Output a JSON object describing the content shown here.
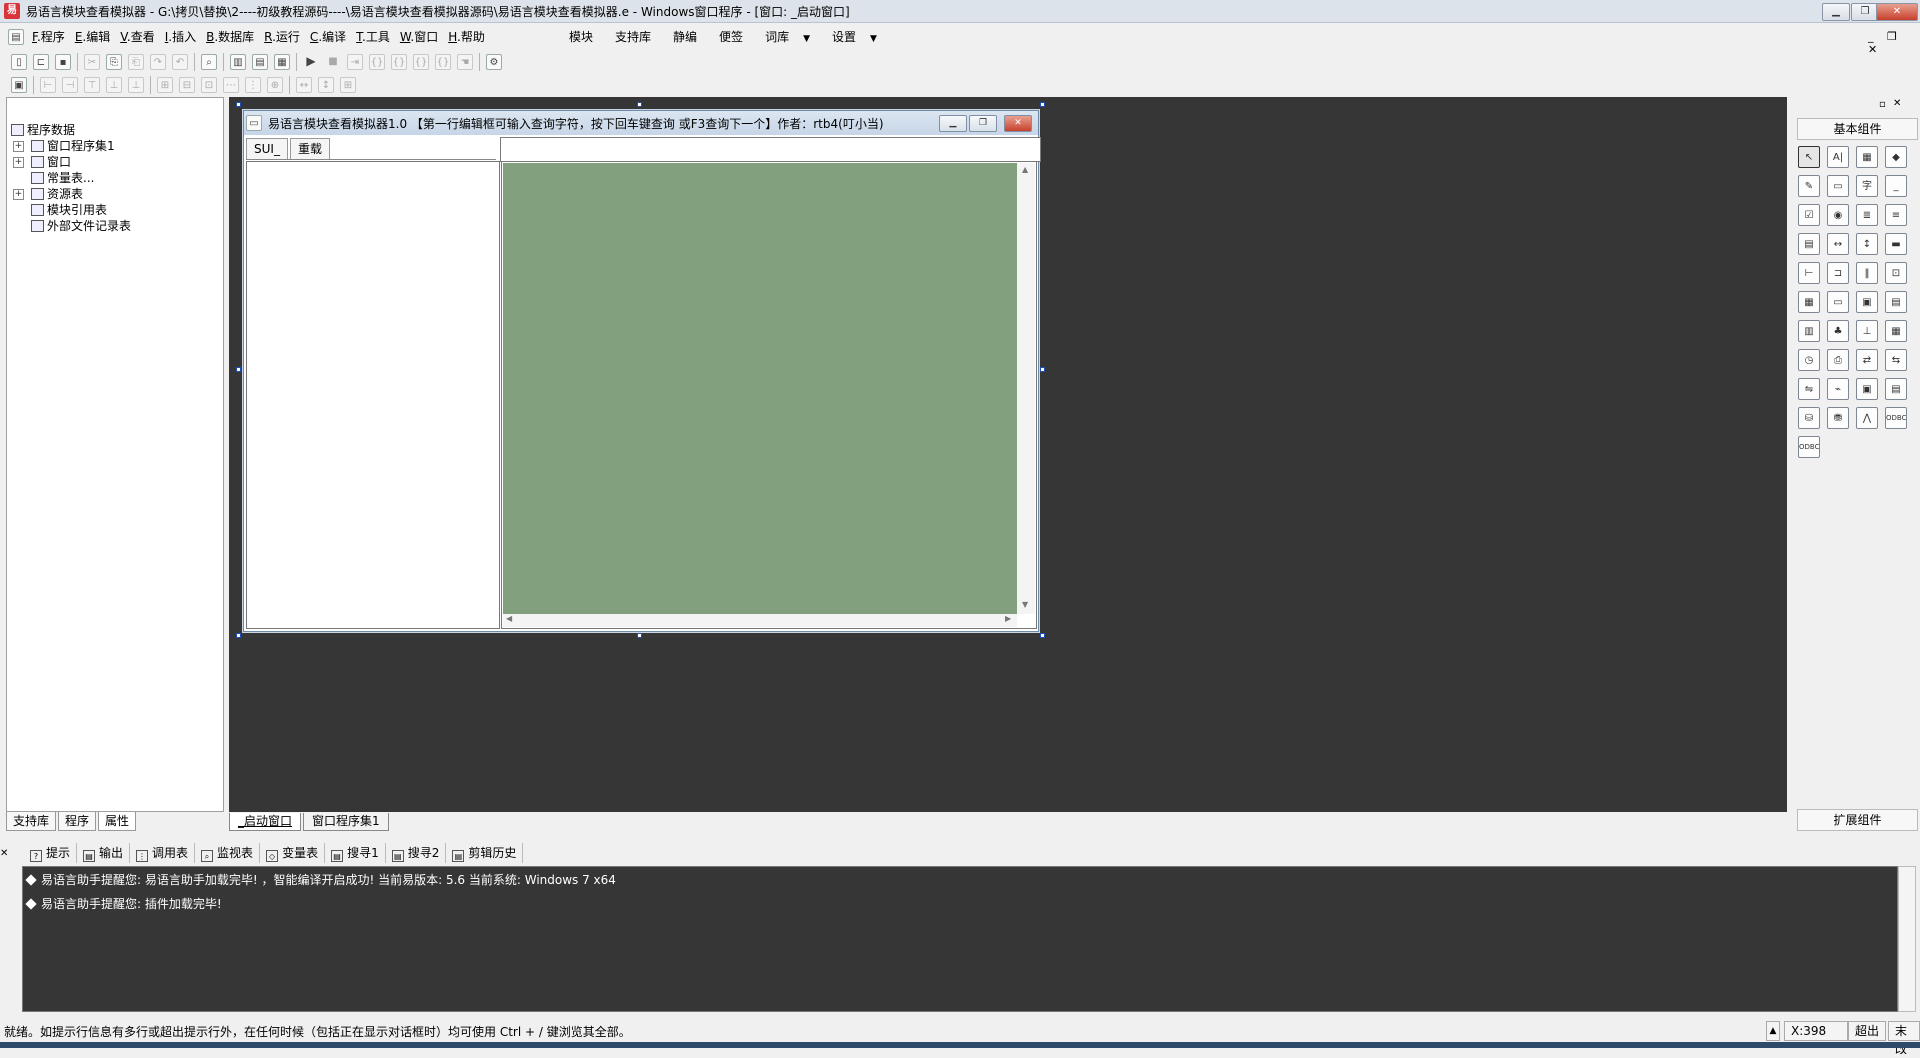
{
  "window": {
    "title": "易语言模块查看模拟器 - G:\\拷贝\\替换\\2----初级教程源码----\\易语言模块查看模拟器源码\\易语言模块查看模拟器.e - Windows窗口程序 - [窗口: _启动窗口]"
  },
  "menu": {
    "items": [
      {
        "key": "F",
        "label": ".程序"
      },
      {
        "key": "E",
        "label": ".编辑"
      },
      {
        "key": "V",
        "label": ".查看"
      },
      {
        "key": "I",
        "label": ".插入"
      },
      {
        "key": "B",
        "label": ".数据库"
      },
      {
        "key": "R",
        "label": ".运行"
      },
      {
        "key": "C",
        "label": ".编译"
      },
      {
        "key": "T",
        "label": ".工具"
      },
      {
        "key": "W",
        "label": ".窗口"
      },
      {
        "key": "H",
        "label": ".帮助"
      }
    ],
    "right_items": [
      "模块",
      "支持库",
      "静编",
      "便签",
      "词库",
      "设置"
    ]
  },
  "tree": {
    "root": "程序数据",
    "items": [
      {
        "label": "窗口程序集1",
        "expander": "+"
      },
      {
        "label": "窗口",
        "expander": "+"
      },
      {
        "label": "常量表...",
        "expander": ""
      },
      {
        "label": "资源表",
        "expander": "+"
      },
      {
        "label": "模块引用表",
        "expander": ""
      },
      {
        "label": "外部文件记录表",
        "expander": ""
      }
    ]
  },
  "left_tabs": [
    "支持库",
    "程序",
    "属性"
  ],
  "form": {
    "title": "易语言模块查看模拟器1.0 【第一行编辑框可输入查询字符，按下回车键查询 或F3查询下一个】作者：rtb4(叮小当)",
    "tabs": [
      "SUI_",
      "重载"
    ],
    "search_value": ""
  },
  "design_tabs": [
    "_启动窗口",
    "窗口程序集1"
  ],
  "components": {
    "header": "基本组件",
    "footer": "扩展组件",
    "icons": [
      {
        "name": "pointer-icon",
        "glyph": "↖"
      },
      {
        "name": "label-icon",
        "glyph": "A|"
      },
      {
        "name": "picture-icon",
        "glyph": "▦"
      },
      {
        "name": "shape-icon",
        "glyph": "◆"
      },
      {
        "name": "drawing-board-icon",
        "glyph": "✎"
      },
      {
        "name": "group-box-icon",
        "glyph": "▭"
      },
      {
        "name": "text-icon",
        "glyph": "字"
      },
      {
        "name": "line-icon",
        "glyph": "_"
      },
      {
        "name": "checkbox-icon",
        "glyph": "☑"
      },
      {
        "name": "radio-icon",
        "glyph": "◉"
      },
      {
        "name": "listbox-icon",
        "glyph": "≣"
      },
      {
        "name": "combobox-icon",
        "glyph": "≡"
      },
      {
        "name": "table-icon",
        "glyph": "▤"
      },
      {
        "name": "hscrollbar-icon",
        "glyph": "↔"
      },
      {
        "name": "vscrollbar-icon",
        "glyph": "↕"
      },
      {
        "name": "progress-icon",
        "glyph": "▬"
      },
      {
        "name": "slider-icon",
        "glyph": "⊢"
      },
      {
        "name": "tab-icon",
        "glyph": "⊐"
      },
      {
        "name": "divider-icon",
        "glyph": "‖"
      },
      {
        "name": "image-box-icon",
        "glyph": "⊡"
      },
      {
        "name": "calendar-icon",
        "glyph": "▦"
      },
      {
        "name": "button-icon",
        "glyph": "▭"
      },
      {
        "name": "folder-icon",
        "glyph": "▣"
      },
      {
        "name": "document-icon",
        "glyph": "▤"
      },
      {
        "name": "toolbar-icon",
        "glyph": "▥"
      },
      {
        "name": "tree-icon",
        "glyph": "♣"
      },
      {
        "name": "status-bar-icon",
        "glyph": "⊥"
      },
      {
        "name": "grid-icon",
        "glyph": "▦"
      },
      {
        "name": "timer-icon",
        "glyph": "◷"
      },
      {
        "name": "printer-icon",
        "glyph": "⎙"
      },
      {
        "name": "network-icon",
        "glyph": "⇄"
      },
      {
        "name": "network-server-icon",
        "glyph": "⇆"
      },
      {
        "name": "client-icon",
        "glyph": "⇋"
      },
      {
        "name": "serial-port-icon",
        "glyph": "⌁"
      },
      {
        "name": "form-icon",
        "glyph": "▣"
      },
      {
        "name": "data-grid-icon",
        "glyph": "▤"
      },
      {
        "name": "data-source-icon",
        "glyph": "⛁"
      },
      {
        "name": "database-icon",
        "glyph": "⛃"
      },
      {
        "name": "chart-icon",
        "glyph": "⋀"
      },
      {
        "name": "odbc-icon",
        "glyph": "ODBC"
      },
      {
        "name": "odbc-source-icon",
        "glyph": "ODBC"
      }
    ]
  },
  "output": {
    "tabs": [
      "提示",
      "输出",
      "调用表",
      "监视表",
      "变量表",
      "搜寻1",
      "搜寻2",
      "剪辑历史"
    ],
    "lines": [
      "易语言助手提醒您: 易语言助手加载完毕!  ，智能编译开启成功!  当前易版本: 5.6  当前系统: Windows 7 x64",
      "易语言助手提醒您: 插件加载完毕!"
    ]
  },
  "status": {
    "text": "就绪。如提示行信息有多行或超出提示行外，在任何时候（包括正在显示对话框时）均可使用 Ctrl + / 键浏览其全部。",
    "coord": "X:398",
    "mode": "超出",
    "extra": "末改"
  },
  "colors": {
    "designer_bg": "#363636",
    "form_view_bg": "#82a07e"
  }
}
